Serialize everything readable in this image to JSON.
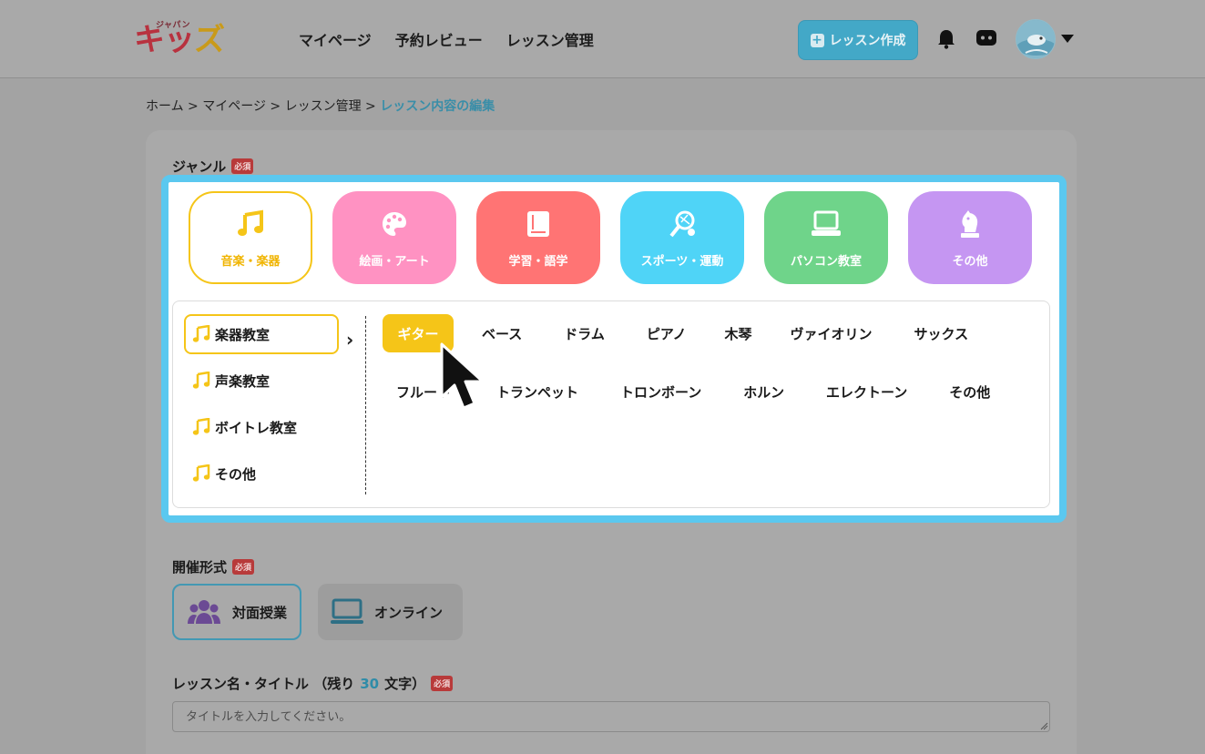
{
  "header": {
    "logo_small": "ジャパン",
    "logo_main_1": "キッ",
    "logo_main_2": "ズ",
    "nav": [
      "マイページ",
      "予約レビュー",
      "レッスン管理"
    ],
    "create_button": "レッスン作成",
    "icons": [
      "bell-icon",
      "chat-icon",
      "avatar",
      "caret-down-icon"
    ]
  },
  "breadcrumb": {
    "items": [
      "ホーム",
      "マイページ",
      "レッスン管理"
    ],
    "separator": " > ",
    "current": "レッスン内容の編集"
  },
  "genre_section": {
    "label": "ジャンル",
    "required": "必須",
    "genres": [
      {
        "label": "音楽・楽器",
        "icon": "music-note-icon",
        "color": "#f5c518",
        "selected": true
      },
      {
        "label": "絵画・アート",
        "icon": "palette-icon",
        "color": "#ff92c2"
      },
      {
        "label": "学習・語学",
        "icon": "book-icon",
        "color": "#ff7474"
      },
      {
        "label": "スポーツ・運動",
        "icon": "racket-icon",
        "color": "#4fd4f7"
      },
      {
        "label": "パソコン教室",
        "icon": "computer-icon",
        "color": "#6fd48a"
      },
      {
        "label": "その他",
        "icon": "chess-knight-icon",
        "color": "#c596f2"
      }
    ],
    "categories": [
      {
        "label": "楽器教室",
        "selected": true
      },
      {
        "label": "声楽教室"
      },
      {
        "label": "ボイトレ教室"
      },
      {
        "label": "その他"
      }
    ],
    "instruments_row1": [
      "ギター",
      "ベース",
      "ドラム",
      "ピアノ",
      "木琴",
      "ヴァイオリン",
      "サックス"
    ],
    "instruments_row2": [
      "フルート",
      "トランペット",
      "トロンボーン",
      "ホルン",
      "エレクトーン",
      "その他"
    ],
    "selected_instrument": "ギター"
  },
  "format_section": {
    "label": "開催形式",
    "required": "必須",
    "options": [
      {
        "label": "対面授業",
        "icon": "group-icon",
        "selected": true
      },
      {
        "label": "オンライン",
        "icon": "monitor-icon"
      }
    ]
  },
  "title_section": {
    "label_prefix": "レッスン名・タイトル （残り",
    "remaining": "30",
    "label_suffix": "文字）",
    "required": "必須",
    "placeholder": "タイトルを入力してください。"
  },
  "colors": {
    "accent_yellow": "#f5c518",
    "panel_border": "#5bc8ef",
    "link_blue": "#3a8ea8"
  }
}
